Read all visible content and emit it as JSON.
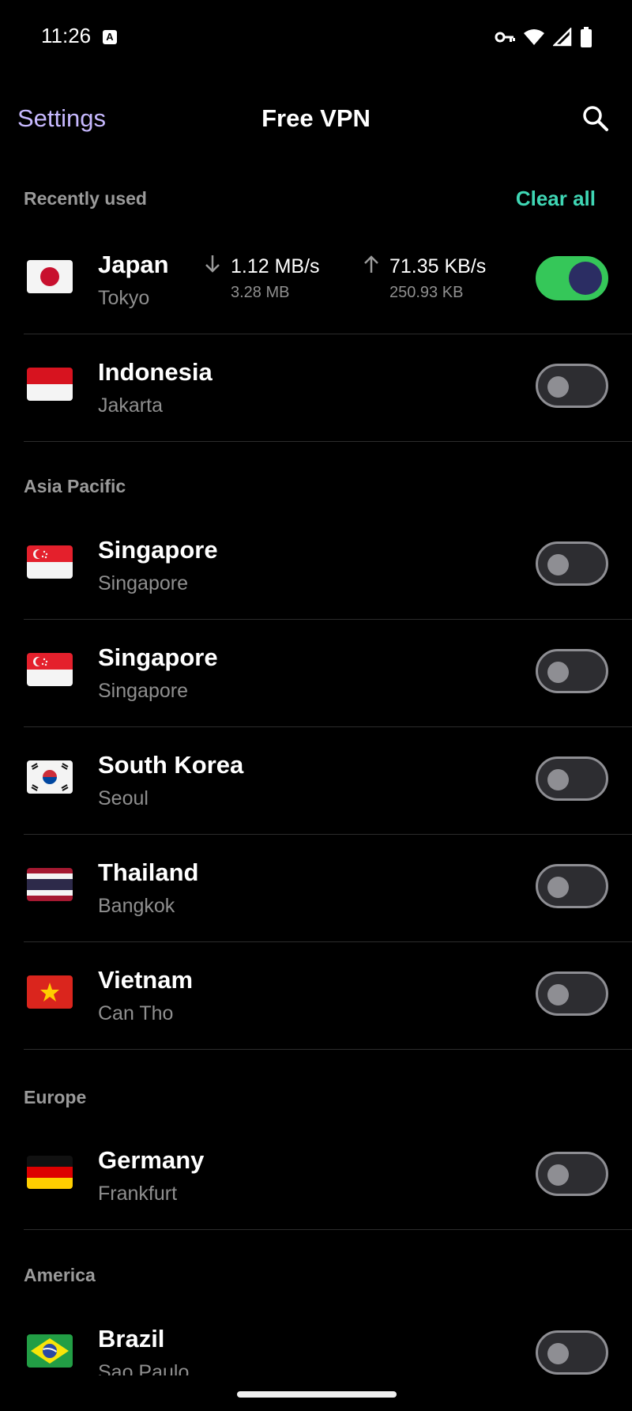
{
  "status_bar": {
    "time": "11:26",
    "notification_icon": "A",
    "icons": [
      "vpn-key-icon",
      "wifi-icon",
      "signal-icon",
      "battery-icon"
    ]
  },
  "app_bar": {
    "settings_label": "Settings",
    "title": "Free VPN",
    "search_icon": "search-icon"
  },
  "colors": {
    "accent_purple": "#c7b9ff",
    "accent_teal": "#3fd6b4",
    "toggle_on": "#35c759",
    "background": "#000000"
  },
  "sections": {
    "recently_used": {
      "title": "Recently used",
      "clear_all_label": "Clear all",
      "items": [
        {
          "country": "Japan",
          "city": "Tokyo",
          "connected": true,
          "download_rate": "1.12 MB/s",
          "download_total": "3.28 MB",
          "upload_rate": "71.35 KB/s",
          "upload_total": "250.93 KB"
        },
        {
          "country": "Indonesia",
          "city": "Jakarta",
          "connected": false
        }
      ]
    },
    "asia_pacific": {
      "title": "Asia Pacific",
      "items": [
        {
          "country": "Singapore",
          "city": "Singapore",
          "connected": false
        },
        {
          "country": "Singapore",
          "city": "Singapore",
          "connected": false
        },
        {
          "country": "South Korea",
          "city": "Seoul",
          "connected": false
        },
        {
          "country": "Thailand",
          "city": "Bangkok",
          "connected": false
        },
        {
          "country": "Vietnam",
          "city": "Can Tho",
          "connected": false
        }
      ]
    },
    "europe": {
      "title": "Europe",
      "items": [
        {
          "country": "Germany",
          "city": "Frankfurt",
          "connected": false
        }
      ]
    },
    "america": {
      "title": "America",
      "items": [
        {
          "country": "Brazil",
          "city": "Sao Paulo",
          "connected": false
        }
      ]
    }
  }
}
